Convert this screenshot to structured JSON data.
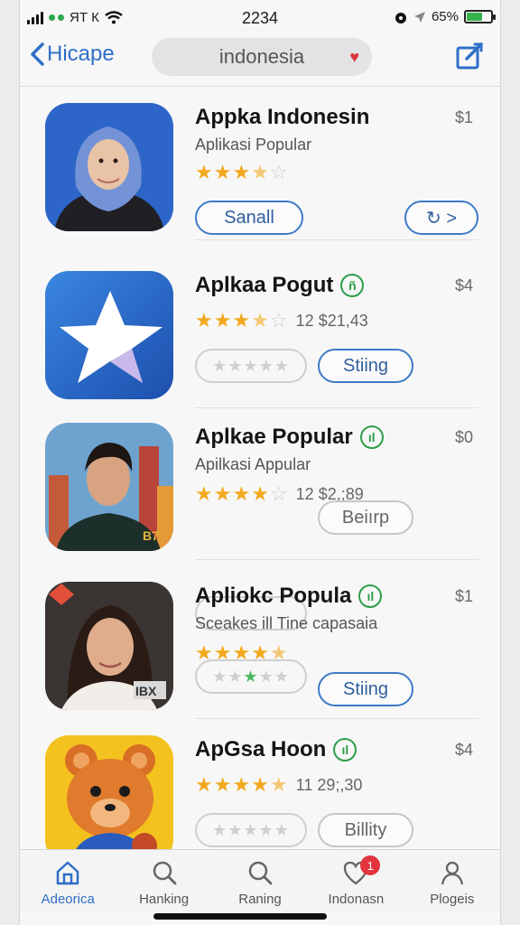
{
  "status": {
    "carrier": "ЯТ К",
    "time": "2234",
    "battery": "65%",
    "battery_level": 0.65
  },
  "nav": {
    "back_label": "Hicape",
    "search_value": "indonesia",
    "heart_glyph": "♥"
  },
  "apps": [
    {
      "title": "Appka Indonesin",
      "subtitle": "Aplikasi Popular",
      "price": "$1",
      "rating": 3.5,
      "rating_count": "",
      "btn1": "Sanall",
      "btn2": "↻ >"
    },
    {
      "title": "Aplkaa Pogut",
      "badge": "ñ",
      "price": "$4",
      "rating": 3.5,
      "rating_count": "12 $21,43",
      "btn2": "Stiing"
    },
    {
      "title": "Aplkae Popular",
      "badge": "ıl",
      "subtitle": "Apilkasi Appular",
      "price": "$0",
      "rating": 4,
      "rating_count": "12 $2,;89",
      "btn2": "Beiırp"
    },
    {
      "title": "Apliokc Popula",
      "badge": "ıl",
      "subtitle": "Sceakes ill Tine capasaia",
      "price": "$1",
      "rating": 4.5,
      "btn2": "Stiing"
    },
    {
      "title": "ApGsa Hoon",
      "badge": "ıl",
      "price": "$4",
      "rating": 4.5,
      "rating_count": "11 29;,30",
      "btn2": "Billity"
    }
  ],
  "tabs": [
    {
      "label": "Adeorica",
      "icon": "home-icon",
      "active": true
    },
    {
      "label": "Hanking",
      "icon": "search-icon"
    },
    {
      "label": "Raning",
      "icon": "search-icon"
    },
    {
      "label": "Indonasn",
      "icon": "heart-icon",
      "badge": "1"
    },
    {
      "label": "Plogeis",
      "icon": "person-icon"
    }
  ],
  "colors": {
    "accent": "#2f6fc8",
    "star": "#f2a91e",
    "badge_green": "#2f9e4a",
    "notification": "#e2353d"
  }
}
